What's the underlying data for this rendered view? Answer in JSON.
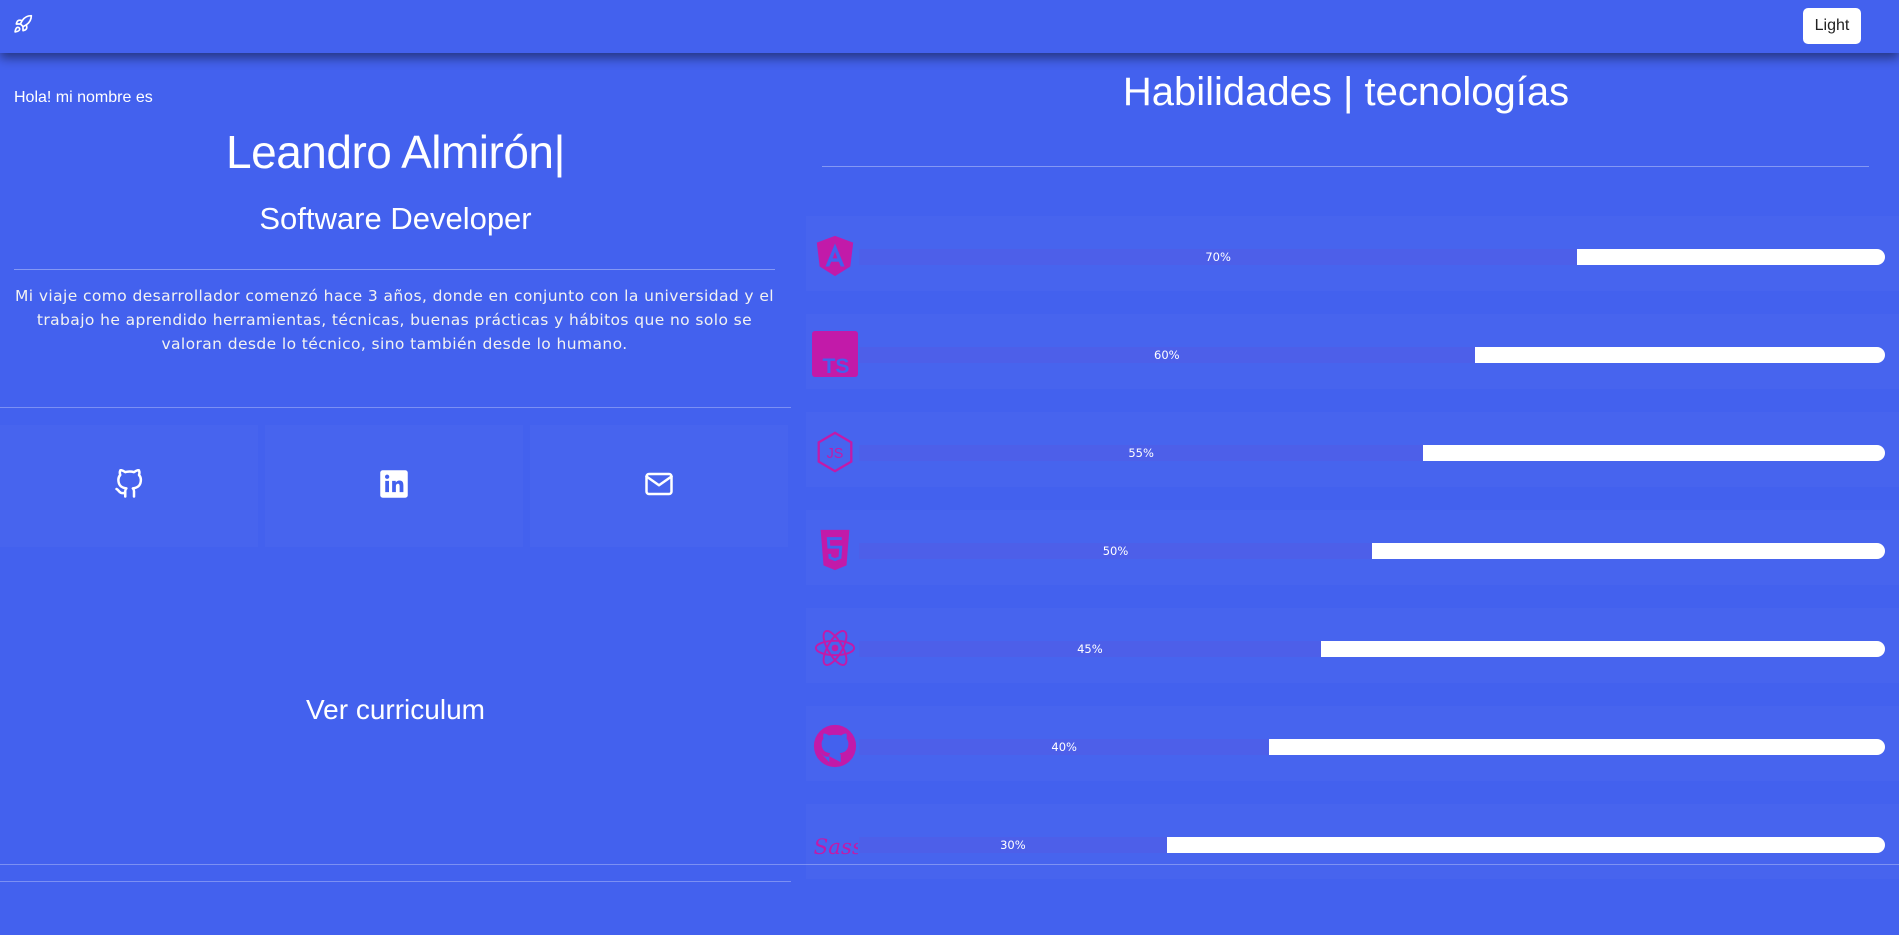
{
  "navbar": {
    "logo_icon": "rocket-icon",
    "theme_label": "Light"
  },
  "hero": {
    "greeting": "Hola! mi nombre es",
    "name": "Leandro Almirón|",
    "role": "Software Developer",
    "bio": "Mi viaje como desarrollador comenzó hace 3 años, donde en conjunto con la universidad y el trabajo he aprendido herramientas, técnicas, buenas prácticas y hábitos que no solo se valoran desde lo técnico, sino también desde lo humano.",
    "social": [
      {
        "icon": "github-icon"
      },
      {
        "icon": "linkedin-icon"
      },
      {
        "icon": "mail-icon"
      }
    ],
    "cv_label": "Ver curriculum"
  },
  "skills": {
    "title": "Habilidades | tecnologías",
    "items": [
      {
        "icon": "angular-icon",
        "percent": 70,
        "label": "70%"
      },
      {
        "icon": "typescript-icon",
        "percent": 60,
        "label": "60%"
      },
      {
        "icon": "nodejs-icon",
        "percent": 55,
        "label": "55%"
      },
      {
        "icon": "html5-icon",
        "percent": 50,
        "label": "50%"
      },
      {
        "icon": "react-icon",
        "percent": 45,
        "label": "45%"
      },
      {
        "icon": "github-icon",
        "percent": 40,
        "label": "40%"
      },
      {
        "icon": "sass-icon",
        "percent": 30,
        "label": "30%"
      }
    ]
  },
  "colors": {
    "background": "#4361ee",
    "bar_track": "#ffffff",
    "bar_fill": "#4d5fe9",
    "skill_icon": "#c21aa9"
  }
}
